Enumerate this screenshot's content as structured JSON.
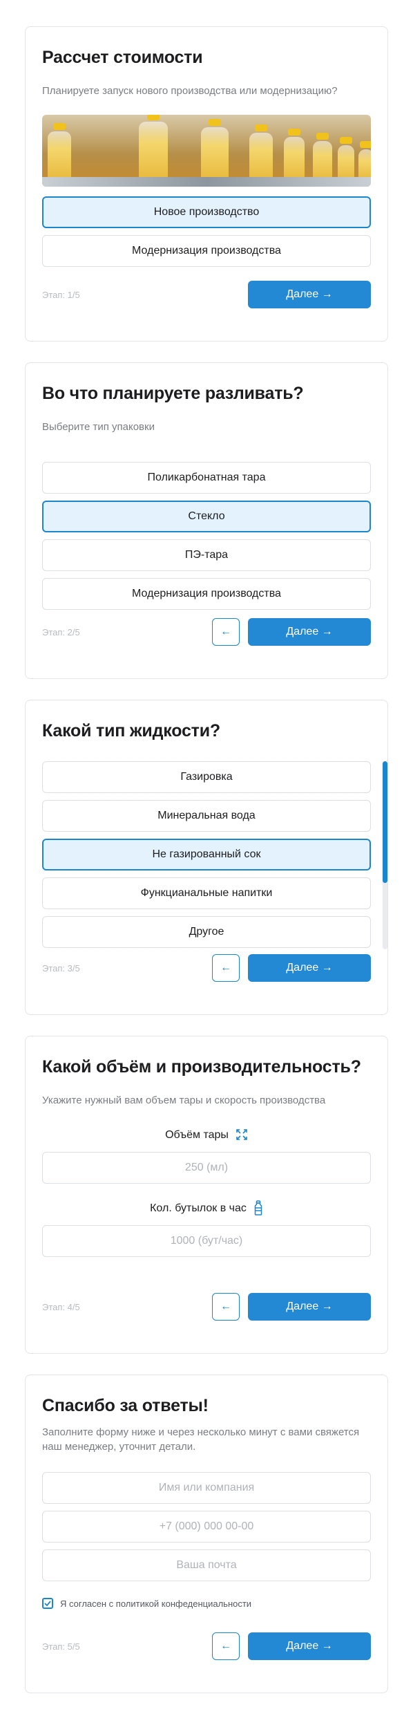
{
  "step1": {
    "title": "Рассчет стоимости",
    "subtitle": "Планируете запуск нового производства или модернизацию?",
    "options": [
      "Новое производство",
      "Модернизация производства"
    ],
    "stage": "Этап: 1/5",
    "next": "Далее →"
  },
  "step2": {
    "title": "Во что планируете разливать?",
    "subtitle": "Выберите тип упаковки",
    "options": [
      "Поликарбонатная тара",
      "Стекло",
      "ПЭ-тара",
      "Модернизация производства"
    ],
    "stage": "Этап: 2/5",
    "back": "←",
    "next": "Далее →"
  },
  "step3": {
    "title": "Какой тип жидкости?",
    "options": [
      "Газировка",
      "Минеральная вода",
      "Не газированный сок",
      "Функцианальные напитки",
      "Другое"
    ],
    "stage": "Этап: 3/5",
    "back": "←",
    "next": "Далее →"
  },
  "step4": {
    "title": "Какой объём и производительность?",
    "subtitle": "Укажите нужный вам объем тары и скорость производства",
    "volume_label": "Объём тары",
    "volume_placeholder": "250 (мл)",
    "rate_label": "Кол. бутылок в час",
    "rate_placeholder": "1000 (бут/час)",
    "stage": "Этап: 4/5",
    "back": "←",
    "next": "Далее →"
  },
  "step5": {
    "title": "Спасибо за ответы!",
    "subtitle": "Заполните форму ниже и через несколько минут с вами свяжется наш менеджер, уточнит детали.",
    "name_placeholder": "Имя или компания",
    "phone_placeholder": "+7 (000) 000 00-00",
    "email_placeholder": "Ваша почта",
    "consent": "Я согласен с политикой конфеденциальности",
    "stage": "Этап: 5/5",
    "back": "←",
    "next": "Далее →"
  },
  "icons": {
    "expand": "expand-arrows-icon",
    "bottle": "bottle-icon",
    "check": "checkmark-icon"
  },
  "colors": {
    "accent": "#1c86cd",
    "selected_bg": "#e3f2fd",
    "button": "#2389d4"
  }
}
